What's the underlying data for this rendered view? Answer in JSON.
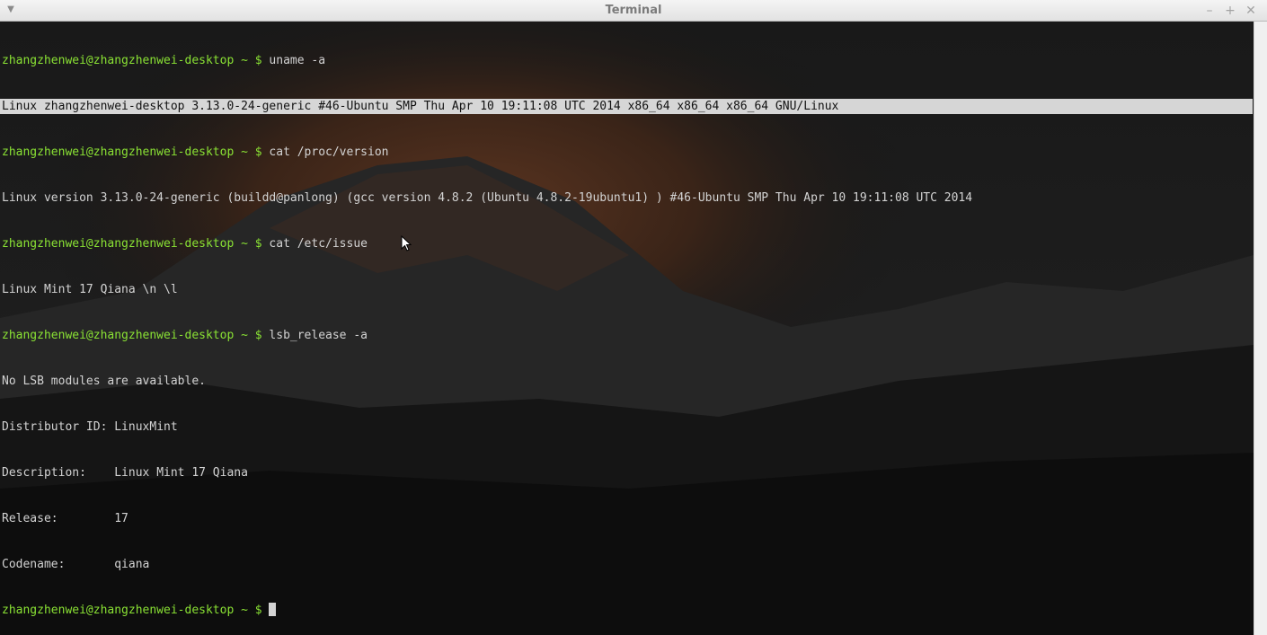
{
  "window": {
    "title": "Terminal",
    "menu_icon": "chevron-down-icon",
    "minimize_icon": "minimize-icon",
    "maximize_icon": "maximize-icon",
    "close_icon": "close-icon"
  },
  "terminal": {
    "prompt": "zhangzhenwei@zhangzhenwei-desktop ~ $",
    "lines": [
      {
        "kind": "prompt",
        "cmd": " uname -a"
      },
      {
        "kind": "output",
        "text": "Linux zhangzhenwei-desktop 3.13.0-24-generic #46-Ubuntu SMP Thu Apr 10 19:11:08 UTC 2014 x86_64 x86_64 x86_64 GNU/Linux"
      },
      {
        "kind": "prompt",
        "cmd": " cat /proc/version"
      },
      {
        "kind": "output",
        "text": "Linux version 3.13.0-24-generic (buildd@panlong) (gcc version 4.8.2 (Ubuntu 4.8.2-19ubuntu1) ) #46-Ubuntu SMP Thu Apr 10 19:11:08 UTC 2014"
      },
      {
        "kind": "prompt",
        "cmd": " cat /etc/issue"
      },
      {
        "kind": "output",
        "text": "Linux Mint 17 Qiana \\n \\l"
      },
      {
        "kind": "prompt",
        "cmd": " lsb_release -a"
      },
      {
        "kind": "output",
        "text": "No LSB modules are available."
      },
      {
        "kind": "output",
        "text": "Distributor ID:\tLinuxMint"
      },
      {
        "kind": "output",
        "text": "Description:\tLinux Mint 17 Qiana"
      },
      {
        "kind": "output",
        "text": "Release:\t17"
      },
      {
        "kind": "output",
        "text": "Codename:\tqiana"
      },
      {
        "kind": "prompt",
        "cmd": " "
      }
    ]
  },
  "colors": {
    "prompt": "#8ae234",
    "text": "#d3d3d3",
    "selection": "#d6d6d6"
  }
}
